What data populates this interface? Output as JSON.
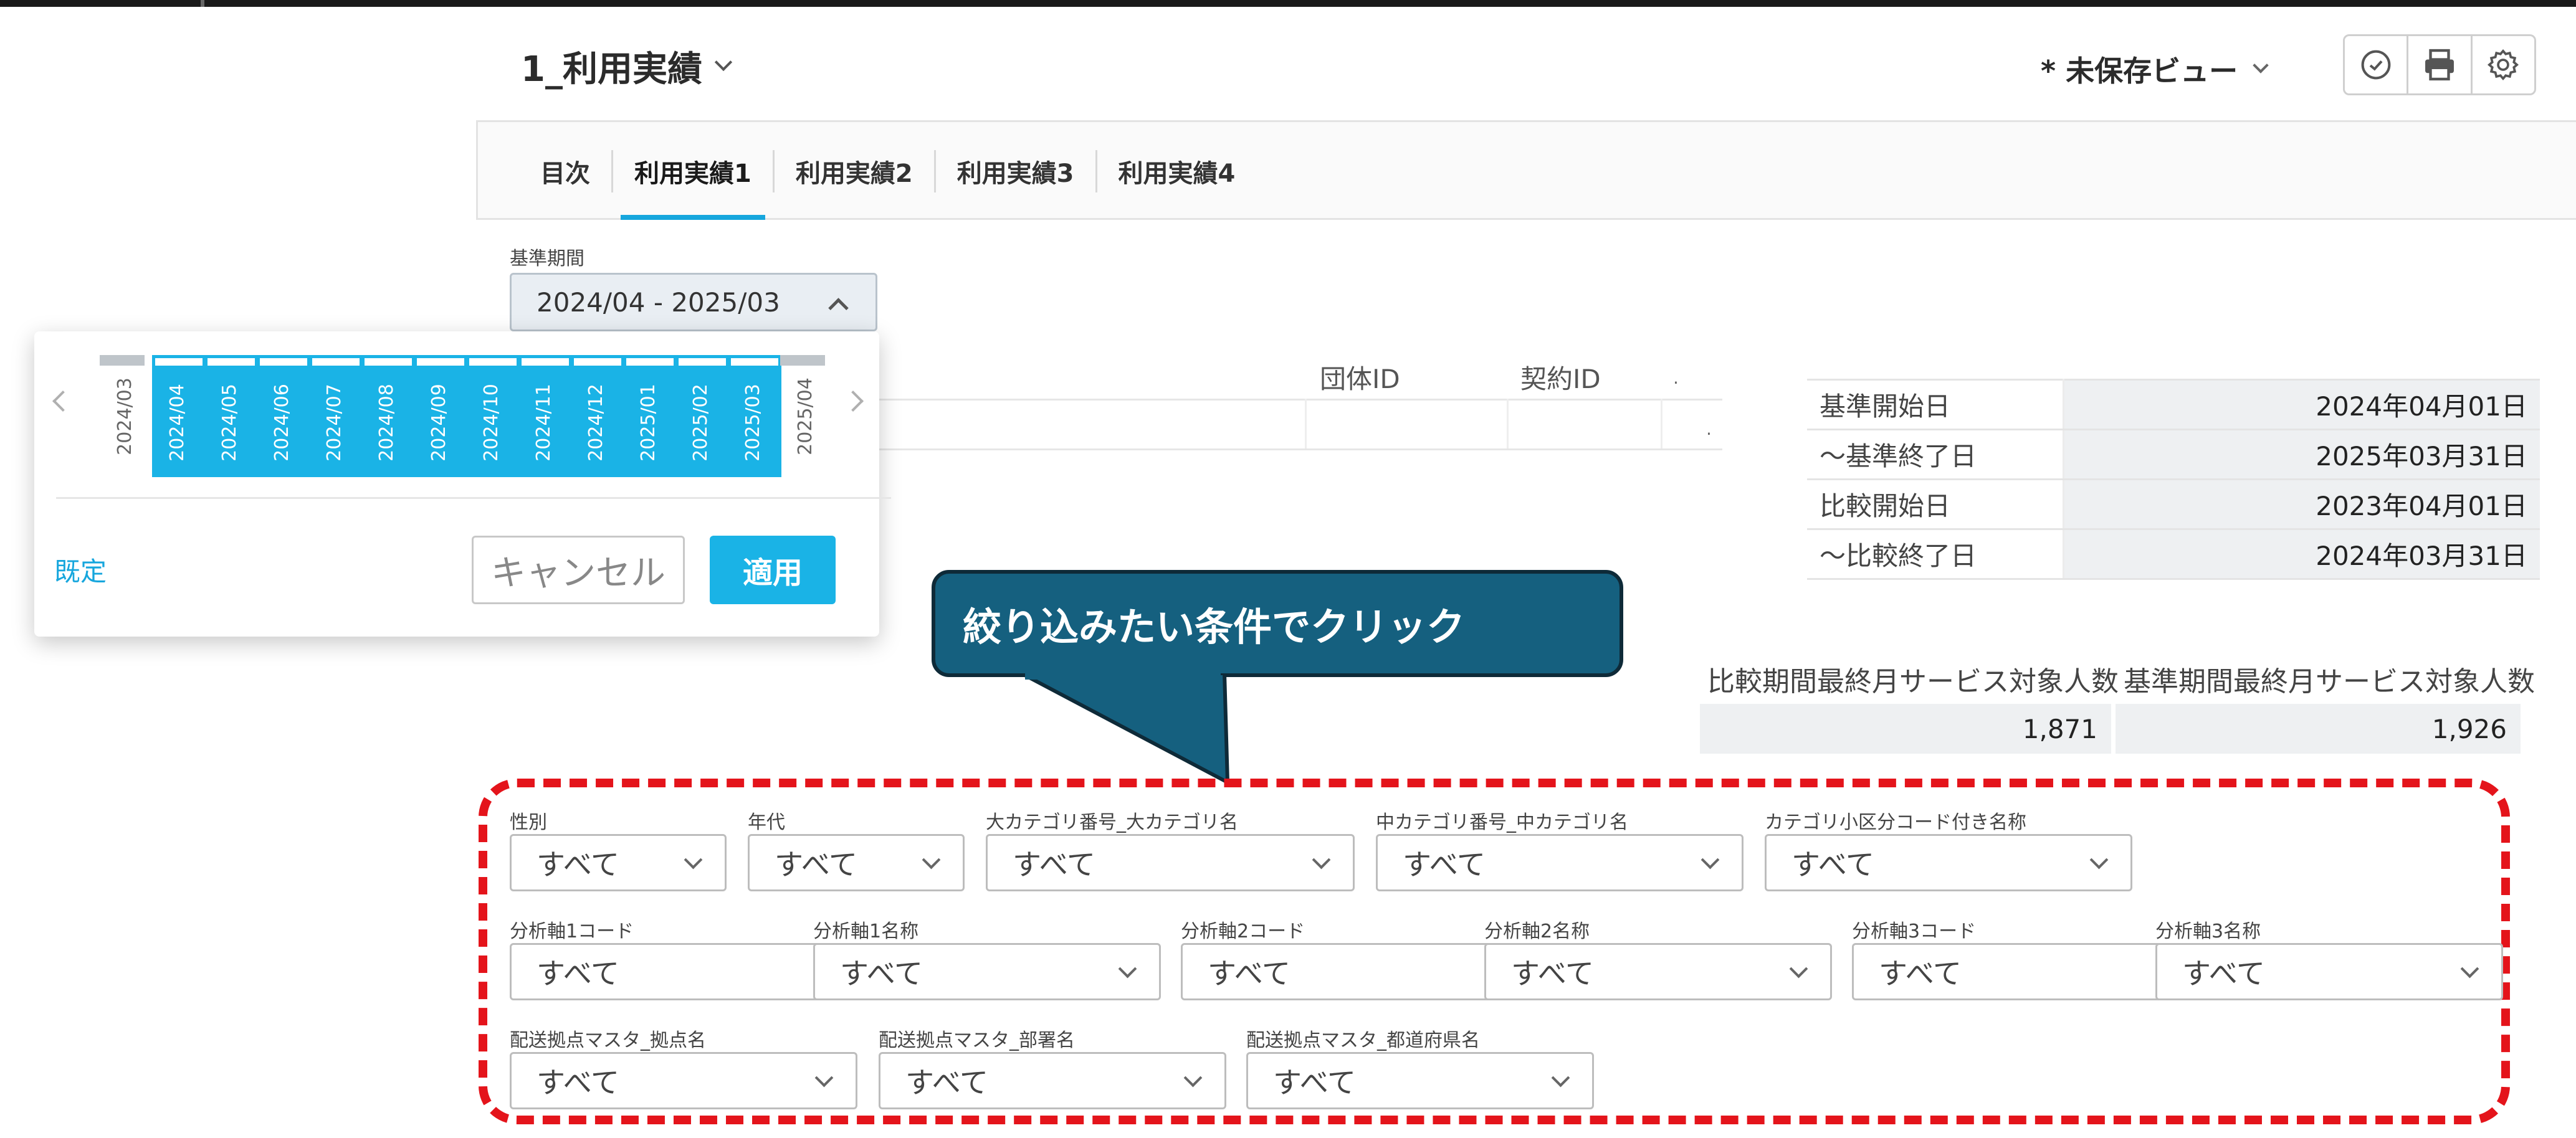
{
  "header": {
    "view_title": "1_利用実績",
    "saved_view": "* 未保存ビュー",
    "toolbar_icons": [
      "clock-icon",
      "print-icon",
      "gear-icon"
    ]
  },
  "tabs": [
    {
      "label": "目次",
      "active": false
    },
    {
      "label": "利用実績1",
      "active": true
    },
    {
      "label": "利用実績2",
      "active": false
    },
    {
      "label": "利用実績3",
      "active": false
    },
    {
      "label": "利用実績4",
      "active": false
    }
  ],
  "period": {
    "label": "基準期間",
    "value": "2024/04 - 2025/03"
  },
  "picker": {
    "months": [
      "2024/03",
      "2024/04",
      "2024/05",
      "2024/06",
      "2024/07",
      "2024/08",
      "2024/09",
      "2024/10",
      "2024/11",
      "2024/12",
      "2025/01",
      "2025/02",
      "2025/03",
      "2025/04"
    ],
    "selected_from": "2024/04",
    "selected_to": "2025/03",
    "default_label": "既定",
    "cancel_label": "キャンセル",
    "apply_label": "適用",
    "accent": "#1ab3e6"
  },
  "id_table": {
    "group_id": "団体ID",
    "contract_id": "契約ID",
    "dot1": ".",
    "dot2": "."
  },
  "dates": [
    {
      "label": "基準開始日",
      "value": "2024年04月01日"
    },
    {
      "label": "～基準終了日",
      "value": "2025年03月31日"
    },
    {
      "label": "比較開始日",
      "value": "2023年04月01日"
    },
    {
      "label": "～比較終了日",
      "value": "2024年03月31日"
    }
  ],
  "counts": {
    "compare_label": "比較期間最終月サービス対象人数",
    "compare_value": "1,871",
    "base_label": "基準期間最終月サービス対象人数",
    "base_value": "1,926"
  },
  "callout": {
    "text": "絞り込みたい条件でクリック",
    "color": "#15607f"
  },
  "filters": {
    "highlight_color": "#e4141b",
    "rows": [
      [
        {
          "label": "性別",
          "value": "すべて"
        },
        {
          "label": "年代",
          "value": "すべて"
        },
        {
          "label": "大カテゴリ番号_大カテゴリ名",
          "value": "すべて"
        },
        {
          "label": "中カテゴリ番号_中カテゴリ名",
          "value": "すべて"
        },
        {
          "label": "カテゴリ小区分コード付き名称",
          "value": "すべて"
        }
      ],
      [
        {
          "label": "分析軸1コード",
          "value": "すべて"
        },
        {
          "label": "分析軸1名称",
          "value": "すべて"
        },
        {
          "label": "分析軸2コード",
          "value": "すべて"
        },
        {
          "label": "分析軸2名称",
          "value": "すべて"
        },
        {
          "label": "分析軸3コード",
          "value": "すべて"
        },
        {
          "label": "分析軸3名称",
          "value": "すべて"
        }
      ],
      [
        {
          "label": "配送拠点マスタ_拠点名",
          "value": "すべて"
        },
        {
          "label": "配送拠点マスタ_部署名",
          "value": "すべて"
        },
        {
          "label": "配送拠点マスタ_都道府県名",
          "value": "すべて"
        }
      ]
    ]
  }
}
